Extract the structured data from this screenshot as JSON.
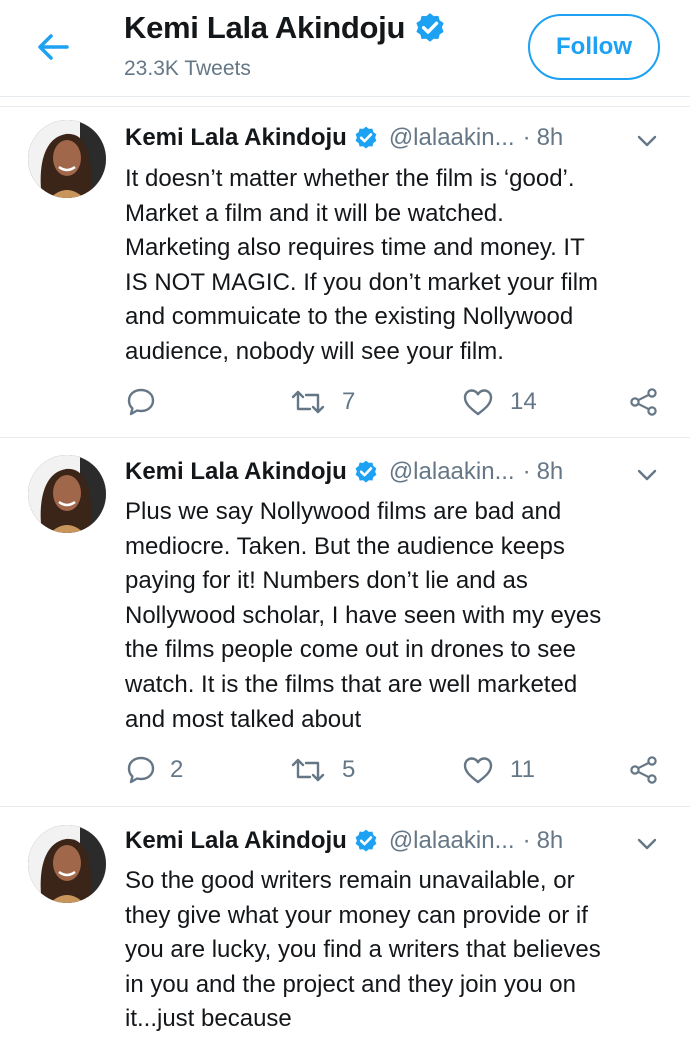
{
  "header": {
    "title": "Kemi Lala Akindoju",
    "tweet_count": "23.3K Tweets",
    "follow_label": "Follow"
  },
  "colors": {
    "accent": "#1da1f2",
    "secondary_text": "#657786",
    "divider": "#e6ecf0"
  },
  "tweets": [
    {
      "name": "Kemi Lala Akindoju",
      "handle": "@lalaakin...",
      "dot": "·",
      "time": "8h",
      "text": "It doesn’t matter whether the film is ‘good’.\nMarket a film and it will be watched.\nMarketing also requires time and money. IT\nIS NOT MAGIC. If you don’t market your film\nand commuicate to the existing Nollywood\naudience, nobody will see your film.",
      "replies": "",
      "retweets": "7",
      "likes": "14"
    },
    {
      "name": "Kemi Lala Akindoju",
      "handle": "@lalaakin...",
      "dot": "·",
      "time": "8h",
      "text": "Plus we say Nollywood films are bad and\nmediocre. Taken. But the audience keeps\npaying for it! Numbers don’t lie and as\nNollywood scholar, I have seen with my eyes\nthe films people come out in drones to see\nwatch. It is the films that are well marketed\nand most talked about",
      "replies": "2",
      "retweets": "5",
      "likes": "11"
    },
    {
      "name": "Kemi Lala Akindoju",
      "handle": "@lalaakin...",
      "dot": "·",
      "time": "8h",
      "text": "So the good writers remain unavailable, or\nthey give what your money can provide or if\nyou are lucky, you find a writers that believes\nin you and the project and they join you on\nit...just because"
    }
  ],
  "icons": [
    "back-arrow-icon",
    "verified-badge-icon",
    "chevron-down-icon",
    "reply-icon",
    "retweet-icon",
    "like-icon",
    "share-icon"
  ]
}
